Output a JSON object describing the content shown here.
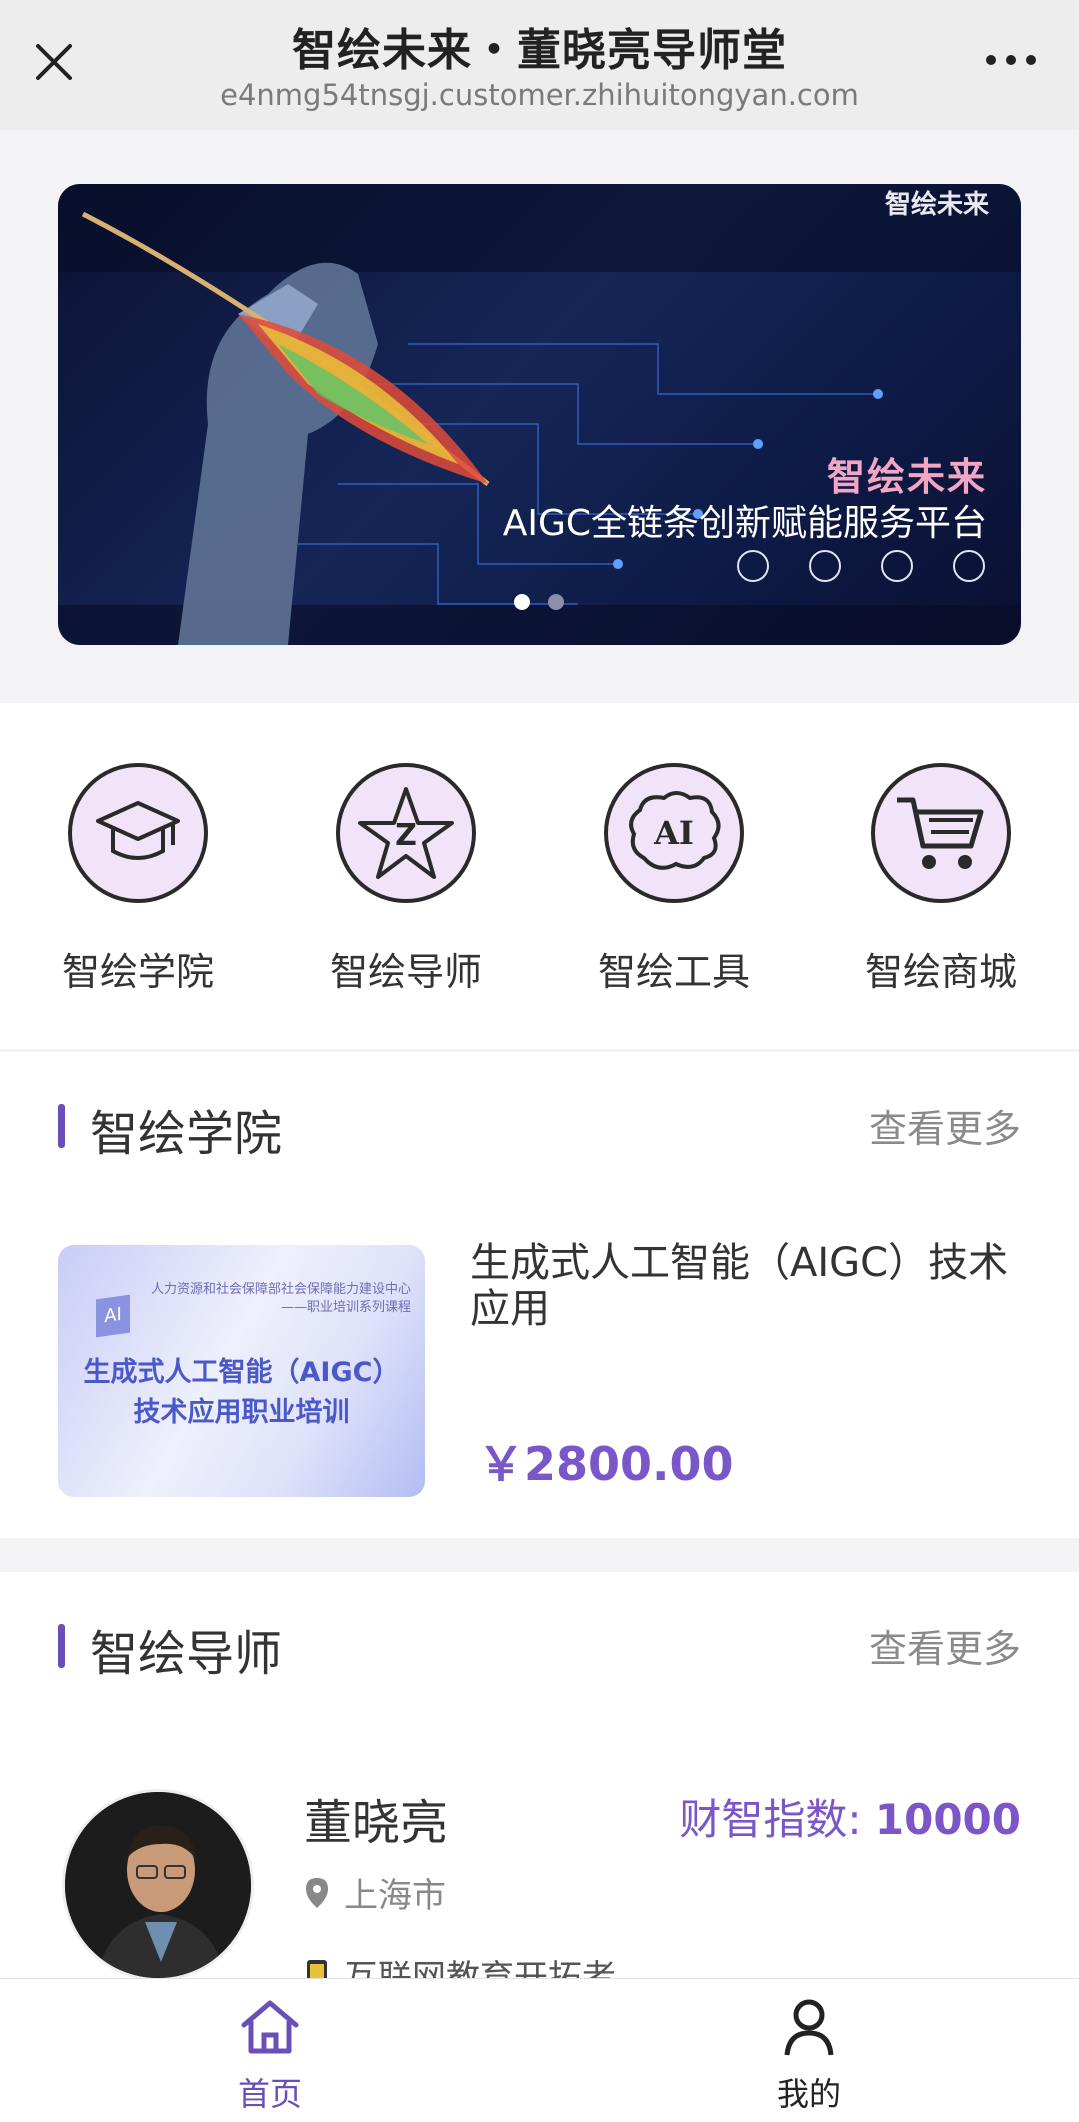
{
  "header": {
    "title": "智绘未来・董晓亮导师堂",
    "url": "e4nmg54tnsgj.customer.zhihuitongyan.com"
  },
  "banner": {
    "logo": "智绘未来",
    "title": "智绘未来",
    "subtitle": "AIGC全链条创新赋能服务平台",
    "slides": 2,
    "active_slide": 1
  },
  "quicknav": {
    "items": [
      {
        "label": "智绘学院",
        "icon": "graduation-cap-icon"
      },
      {
        "label": "智绘导师",
        "icon": "star-icon"
      },
      {
        "label": "智绘工具",
        "icon": "ai-brain-icon"
      },
      {
        "label": "智绘商城",
        "icon": "shopping-cart-icon"
      }
    ]
  },
  "academy": {
    "title": "智绘学院",
    "more": "查看更多",
    "course": {
      "image_header": "人力资源和社会保障部社会保障能力建设中心\n——职业培训系列课程",
      "image_ai": "AI",
      "image_title": "生成式人工智能（AIGC）\n技术应用职业培训",
      "name": "生成式人工智能（AIGC）技术应用",
      "price": "￥2800.00"
    }
  },
  "mentor": {
    "title": "智绘导师",
    "more": "查看更多",
    "teacher": {
      "name": "董晓亮",
      "score_label": "财智指数:",
      "score_value": "10000",
      "city": "上海市",
      "tag": "互联网教育开拓者"
    }
  },
  "tabbar": {
    "items": [
      {
        "label": "首页",
        "active": true
      },
      {
        "label": "我的",
        "active": false
      }
    ]
  },
  "colors": {
    "accent": "#6a4fb8",
    "price": "#7b56c9",
    "icon_bg": "#f1e4f8"
  }
}
